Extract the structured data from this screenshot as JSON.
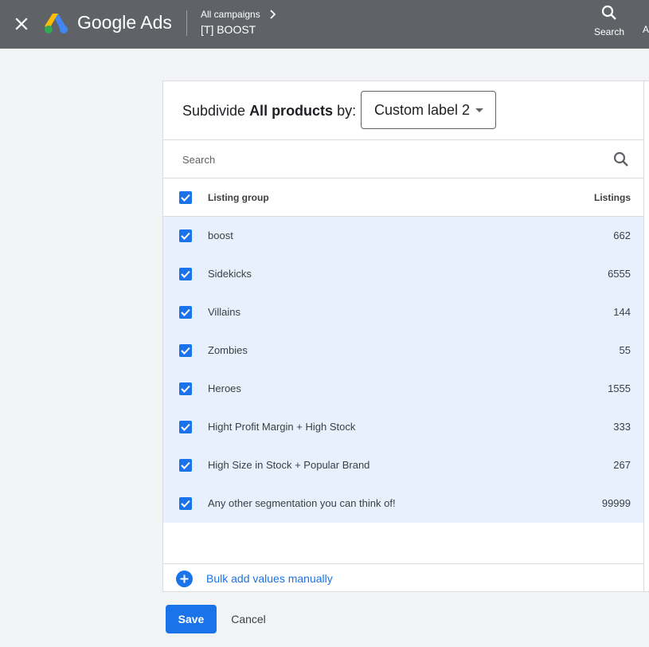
{
  "header": {
    "brand": "Google Ads",
    "breadcrumb": "All campaigns",
    "campaign": "[T] BOOST",
    "search_label": "Search",
    "cut_label": "A"
  },
  "panel": {
    "subdivide_prefix": "Subdivide ",
    "subdivide_bold": "All products",
    "subdivide_suffix": " by:",
    "dropdown_value": "Custom label 2",
    "search_placeholder": "Search",
    "col_listing_group": "Listing group",
    "col_listings": "Listings",
    "rows": [
      {
        "name": "boost",
        "count": "662"
      },
      {
        "name": "Sidekicks",
        "count": "6555"
      },
      {
        "name": "Villains",
        "count": "144"
      },
      {
        "name": "Zombies",
        "count": "55"
      },
      {
        "name": "Heroes",
        "count": "1555"
      },
      {
        "name": "Hight Profit Margin + High Stock",
        "count": "333"
      },
      {
        "name": "High Size in Stock + Popular Brand",
        "count": "267"
      },
      {
        "name": "Any other segmentation you can think of!",
        "count": "99999"
      }
    ],
    "bulk_add": "Bulk add values manually"
  },
  "footer": {
    "save": "Save",
    "cancel": "Cancel"
  },
  "colors": {
    "topbar": "#5f6368",
    "accent": "#1a73e8",
    "row_selected": "#e8f0fe"
  }
}
